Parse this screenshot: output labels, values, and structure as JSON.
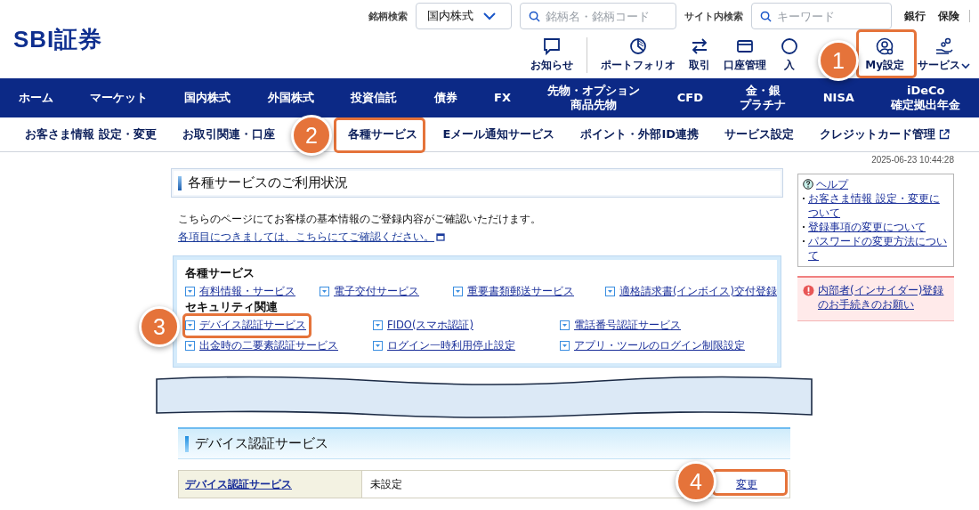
{
  "header": {
    "logo": "SBI証券",
    "stock_search": {
      "label": "銘柄検索",
      "market": "国内株式",
      "placeholder": "銘柄名・銘柄コード"
    },
    "site_search": {
      "label": "サイト内検索",
      "placeholder": "キーワード"
    },
    "top_links": [
      "銀行",
      "保険"
    ],
    "quick_links": [
      {
        "label": "お知らせ",
        "dropdown": false
      },
      {
        "label": "ポートフォリオ",
        "dropdown": false
      },
      {
        "label": "取引",
        "dropdown": false
      },
      {
        "label": "口座管理",
        "dropdown": false
      },
      {
        "label": "入",
        "dropdown": false
      },
      {
        "label": "My設定",
        "dropdown": false
      },
      {
        "label": "サービス",
        "dropdown": true
      }
    ]
  },
  "main_nav": [
    {
      "lines": [
        "ホーム"
      ]
    },
    {
      "lines": [
        "マーケット"
      ]
    },
    {
      "lines": [
        "国内株式"
      ]
    },
    {
      "lines": [
        "外国株式"
      ]
    },
    {
      "lines": [
        "投資信託"
      ]
    },
    {
      "lines": [
        "債券"
      ]
    },
    {
      "lines": [
        "FX"
      ]
    },
    {
      "lines": [
        "先物・オプション",
        "商品先物"
      ]
    },
    {
      "lines": [
        "CFD"
      ]
    },
    {
      "lines": [
        "金・銀",
        "プラチナ"
      ]
    },
    {
      "lines": [
        "NISA"
      ]
    },
    {
      "lines": [
        "iDeCo",
        "確定拠出年金"
      ]
    }
  ],
  "sub_nav": [
    {
      "label": "お客さま情報 設定・変更",
      "external": false
    },
    {
      "label": "お取引関連・口座",
      "external": false
    },
    {
      "label": "各種サービス",
      "external": false
    },
    {
      "label": "Eメール通知サービス",
      "external": false
    },
    {
      "label": "ポイント・外部ID連携",
      "external": false
    },
    {
      "label": "サービス設定",
      "external": false
    },
    {
      "label": "クレジットカード管理",
      "external": true
    }
  ],
  "timestamp": "2025-06-23 10:44:28",
  "page_title": "各種サービスのご利用状況",
  "intro": "こちらのページにてお客様の基本情報のご登録内容がご確認いただけます。",
  "intro_link": "各項目につきましては、こちらにてご確認ください。",
  "service_groups": [
    {
      "title": "各種サービス",
      "links": [
        "有料情報・サービス",
        "電子交付サービス",
        "重要書類郵送サービス",
        "適格請求書(インボイス)交付登録"
      ]
    },
    {
      "title": "セキュリティ関連",
      "links": [
        "デバイス認証サービス",
        "FIDO(スマホ認証)",
        "電話番号認証サービス",
        "出金時の二要素認証サービス",
        "ログイン一時利用停止設定",
        "アプリ・ツールのログイン制限設定"
      ]
    }
  ],
  "help": {
    "title": "ヘルプ",
    "links": [
      "お客さま情報 設定・変更について",
      "登録事項の変更について",
      "パスワードの変更方法について"
    ]
  },
  "notice": {
    "link": "内部者(インサイダー)登録のお手続きのお願い"
  },
  "section": {
    "title": "デバイス認証サービス",
    "rows": [
      {
        "label": "デバイス認証サービス",
        "value": "未設定",
        "action": "変更"
      }
    ]
  },
  "annotations": [
    {
      "label": "1"
    },
    {
      "label": "2"
    },
    {
      "label": "3"
    },
    {
      "label": "4"
    }
  ]
}
